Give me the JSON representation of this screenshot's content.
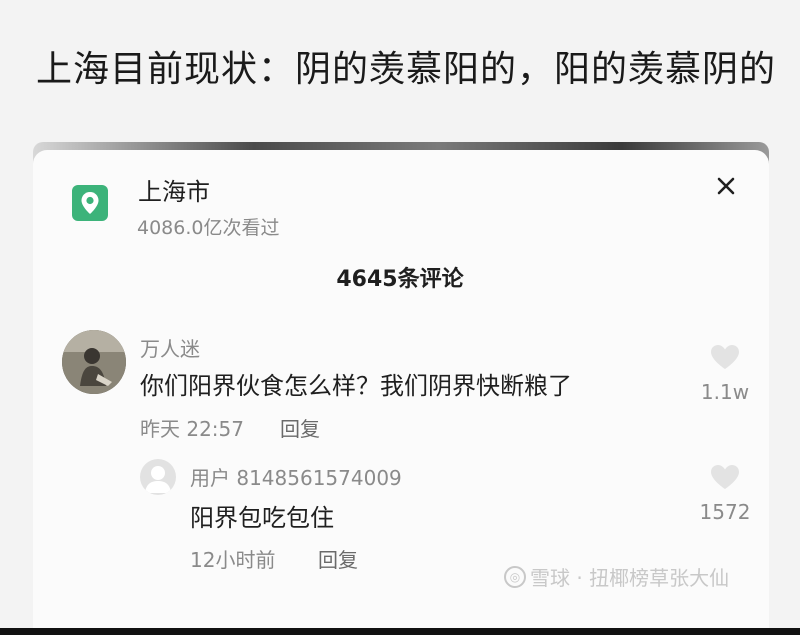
{
  "headline": "上海目前现状：阴的羡慕阳的，阳的羡慕阴的",
  "location": {
    "name": "上海市",
    "views": "4086.0亿次看过",
    "icon": "location-pin-icon"
  },
  "comments_header": "4645条评论",
  "comments": [
    {
      "user": "万人迷",
      "text": "你们阳界伙食怎么样？我们阴界快断粮了",
      "time": "昨天 22:57",
      "reply_label": "回复",
      "likes": "1.1w"
    }
  ],
  "reply": {
    "user": "用户 8148561574009",
    "text": "阳界包吃包住",
    "time": "12小时前",
    "reply_label": "回复",
    "likes": "1572"
  },
  "watermark": "雪球 · 扭椰榜草张大仙",
  "colors": {
    "accent_green": "#3cb37a",
    "text_primary": "#1f1f1f",
    "text_secondary": "#8a8a8a"
  }
}
